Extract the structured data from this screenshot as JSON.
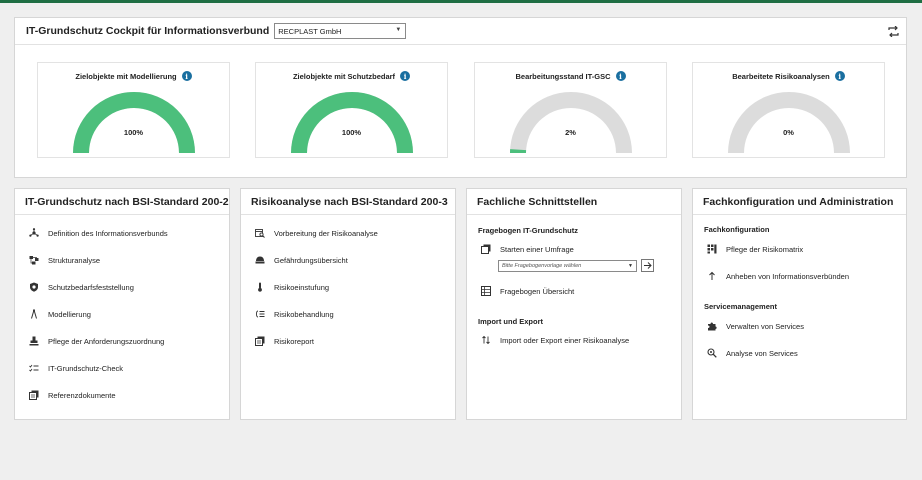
{
  "cockpit": {
    "title": "IT-Grundschutz Cockpit für Informationsverbund",
    "selected_verbund": "RECPLAST GmbH",
    "refresh_icon": "refresh-icon"
  },
  "gauges": [
    {
      "title": "Zielobjekte mit Modellierung",
      "value_text": "100%",
      "value": 100,
      "color": "#4cbf7c"
    },
    {
      "title": "Zielobjekte mit Schutzbedarf",
      "value_text": "100%",
      "value": 100,
      "color": "#4cbf7c"
    },
    {
      "title": "Bearbeitungsstand IT-GSC",
      "value_text": "2%",
      "value": 2,
      "color": "#4cbf7c"
    },
    {
      "title": "Bearbeitete Risikoanalysen",
      "value_text": "0%",
      "value": 0,
      "color": "#4cbf7c"
    }
  ],
  "panels": {
    "bsi2002": {
      "title": "IT-Grundschutz nach BSI-Standard 200-2",
      "items": [
        {
          "label": "Definition des Informationsverbunds",
          "icon": "network-icon"
        },
        {
          "label": "Strukturanalyse",
          "icon": "structure-icon"
        },
        {
          "label": "Schutzbedarfsfeststellung",
          "icon": "shield-icon"
        },
        {
          "label": "Modellierung",
          "icon": "modelling-icon"
        },
        {
          "label": "Pflege der Anforderungszuordnung",
          "icon": "stamp-icon"
        },
        {
          "label": "IT-Grundschutz-Check",
          "icon": "check-list-icon"
        },
        {
          "label": "Referenzdokumente",
          "icon": "documents-icon"
        }
      ]
    },
    "bsi2003": {
      "title": "Risikoanalyse nach BSI-Standard 200-3",
      "items": [
        {
          "label": "Vorbereitung der Risikoanalyse",
          "icon": "calendar-search-icon"
        },
        {
          "label": "Gefährdungsübersicht",
          "icon": "hazard-icon"
        },
        {
          "label": "Risikoeinstufung",
          "icon": "thermometer-icon"
        },
        {
          "label": "Risikobehandlung",
          "icon": "list-treatment-icon"
        },
        {
          "label": "Risikoreport",
          "icon": "report-icon"
        }
      ]
    },
    "schnittstellen": {
      "title": "Fachliche Schnittstellen",
      "fragebogen_label": "Fragebogen IT-Grundschutz",
      "start_survey": "Starten einer Umfrage",
      "survey_placeholder": "Bitte Fragebogenvorlage wählen",
      "overview": "Fragebogen Übersicht",
      "import_label": "Import und Export",
      "import_item": "Import oder Export einer Risikoanalyse"
    },
    "admin": {
      "title": "Fachkonfiguration und Administration",
      "fachkonfig_label": "Fachkonfiguration",
      "fachkonfig_items": [
        {
          "label": "Pflege der Risikomatrix",
          "icon": "matrix-icon"
        },
        {
          "label": "Anheben von Informationsverbünden",
          "icon": "raise-icon"
        }
      ],
      "service_label": "Servicemanagement",
      "service_items": [
        {
          "label": "Verwalten von Services",
          "icon": "puzzle-icon"
        },
        {
          "label": "Analyse von Services",
          "icon": "search-analysis-icon"
        }
      ]
    }
  }
}
